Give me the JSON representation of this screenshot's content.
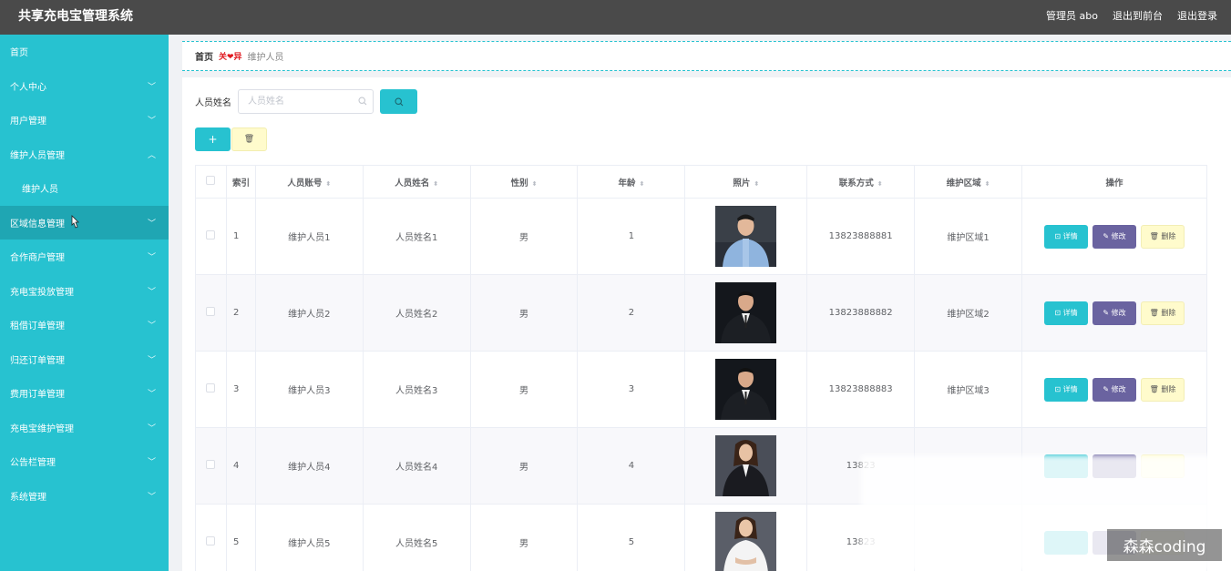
{
  "app": {
    "title": "共享充电宝管理系统",
    "user_label": "管理员 abo",
    "to_front": "退出到前台",
    "logout": "退出登录"
  },
  "sidebar": {
    "items": [
      {
        "label": "首页",
        "chevron": ""
      },
      {
        "label": "个人中心",
        "chevron": "chevron-down"
      },
      {
        "label": "用户管理",
        "chevron": "chevron-down"
      },
      {
        "label": "维护人员管理",
        "chevron": "chevron-up"
      },
      {
        "label": "维护人员",
        "chevron": ""
      },
      {
        "label": "区域信息管理",
        "chevron": "chevron-down"
      },
      {
        "label": "合作商户管理",
        "chevron": "chevron-down"
      },
      {
        "label": "充电宝投放管理",
        "chevron": "chevron-down"
      },
      {
        "label": "租借订单管理",
        "chevron": "chevron-down"
      },
      {
        "label": "归还订单管理",
        "chevron": "chevron-down"
      },
      {
        "label": "费用订单管理",
        "chevron": "chevron-down"
      },
      {
        "label": "充电宝维护管理",
        "chevron": "chevron-down"
      },
      {
        "label": "公告栏管理",
        "chevron": "chevron-down"
      },
      {
        "label": "系统管理",
        "chevron": "chevron-down"
      }
    ]
  },
  "breadcrumb": {
    "home": "首页",
    "separator": "关❤异",
    "current": "维护人员"
  },
  "search": {
    "label": "人员姓名",
    "placeholder": "人员姓名"
  },
  "table": {
    "headers": {
      "index": "索引",
      "account": "人员账号",
      "name": "人员姓名",
      "gender": "性别",
      "age": "年龄",
      "photo": "照片",
      "phone": "联系方式",
      "area": "维护区域",
      "ops": "操作"
    },
    "rows": [
      {
        "index": "1",
        "account": "维护人员1",
        "name": "人员姓名1",
        "gender": "男",
        "age": "1",
        "phone": "13823888881",
        "area": "维护区域1"
      },
      {
        "index": "2",
        "account": "维护人员2",
        "name": "人员姓名2",
        "gender": "男",
        "age": "2",
        "phone": "13823888882",
        "area": "维护区域2"
      },
      {
        "index": "3",
        "account": "维护人员3",
        "name": "人员姓名3",
        "gender": "男",
        "age": "3",
        "phone": "13823888883",
        "area": "维护区域3"
      },
      {
        "index": "4",
        "account": "维护人员4",
        "name": "人员姓名4",
        "gender": "男",
        "age": "4",
        "phone": "13823",
        "area": ""
      },
      {
        "index": "5",
        "account": "维护人员5",
        "name": "人员姓名5",
        "gender": "男",
        "age": "5",
        "phone": "13823",
        "area": ""
      }
    ],
    "ops": {
      "detail": "详情",
      "edit": "修改",
      "delete": "删除"
    }
  },
  "colors": {
    "accent": "#27c2d0",
    "topbar": "#4a4a4a",
    "edit": "#6a63a0",
    "delete": "#fffbcc"
  },
  "watermark": "森森coding"
}
